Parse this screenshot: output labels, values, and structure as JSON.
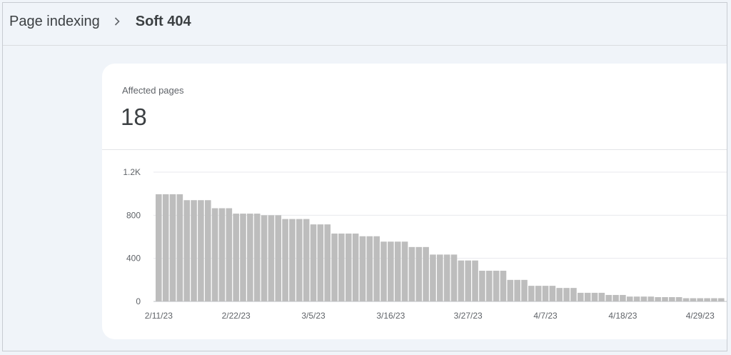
{
  "header": {
    "breadcrumb_parent": "Page indexing",
    "breadcrumb_current": "Soft 404",
    "separator_icon": "chevron-right-icon"
  },
  "summary": {
    "metric_label": "Affected pages",
    "metric_value": "18"
  },
  "colors": {
    "bar": "#bdbdbd",
    "gridline": "#e8eaed",
    "background": "#f0f4f9"
  },
  "chart_data": {
    "type": "bar",
    "title": "",
    "xlabel": "",
    "ylabel": "",
    "ylim": [
      0,
      1200
    ],
    "y_ticks": [
      {
        "value": 0,
        "label": "0"
      },
      {
        "value": 400,
        "label": "400"
      },
      {
        "value": 800,
        "label": "800"
      },
      {
        "value": 1200,
        "label": "1.2K"
      }
    ],
    "grid": true,
    "x_tick_labels": [
      "2/11/23",
      "2/22/23",
      "3/5/23",
      "3/16/23",
      "3/27/23",
      "4/7/23",
      "4/18/23",
      "4/29/23"
    ],
    "dates": [
      "2/11/23",
      "2/12/23",
      "2/13/23",
      "2/14/23",
      "2/15/23",
      "2/16/23",
      "2/17/23",
      "2/18/23",
      "2/19/23",
      "2/20/23",
      "2/21/23",
      "2/22/23",
      "2/23/23",
      "2/24/23",
      "2/25/23",
      "2/26/23",
      "2/27/23",
      "2/28/23",
      "3/1/23",
      "3/2/23",
      "3/3/23",
      "3/4/23",
      "3/5/23",
      "3/6/23",
      "3/7/23",
      "3/8/23",
      "3/9/23",
      "3/10/23",
      "3/11/23",
      "3/12/23",
      "3/13/23",
      "3/14/23",
      "3/15/23",
      "3/16/23",
      "3/17/23",
      "3/18/23",
      "3/19/23",
      "3/20/23",
      "3/21/23",
      "3/22/23",
      "3/23/23",
      "3/24/23",
      "3/25/23",
      "3/26/23",
      "3/27/23",
      "3/28/23",
      "3/29/23",
      "3/30/23",
      "3/31/23",
      "4/1/23",
      "4/2/23",
      "4/3/23",
      "4/4/23",
      "4/5/23",
      "4/6/23",
      "4/7/23",
      "4/8/23",
      "4/9/23",
      "4/10/23",
      "4/11/23",
      "4/12/23",
      "4/13/23",
      "4/14/23",
      "4/15/23",
      "4/16/23",
      "4/17/23",
      "4/18/23",
      "4/19/23",
      "4/20/23",
      "4/21/23",
      "4/22/23",
      "4/23/23",
      "4/24/23",
      "4/25/23",
      "4/26/23",
      "4/27/23",
      "4/28/23",
      "4/29/23",
      "4/30/23",
      "5/1/23",
      "5/2/23"
    ],
    "values": [
      995,
      995,
      995,
      995,
      940,
      940,
      940,
      940,
      865,
      865,
      865,
      815,
      815,
      815,
      815,
      800,
      800,
      800,
      765,
      765,
      765,
      765,
      715,
      715,
      715,
      630,
      630,
      630,
      630,
      605,
      605,
      605,
      555,
      555,
      555,
      555,
      505,
      505,
      505,
      435,
      435,
      435,
      435,
      380,
      380,
      380,
      285,
      285,
      285,
      285,
      200,
      200,
      200,
      145,
      145,
      145,
      145,
      125,
      125,
      125,
      80,
      80,
      80,
      80,
      60,
      60,
      60,
      45,
      45,
      45,
      45,
      40,
      40,
      40,
      40,
      30,
      30,
      30,
      30,
      30,
      30
    ]
  }
}
